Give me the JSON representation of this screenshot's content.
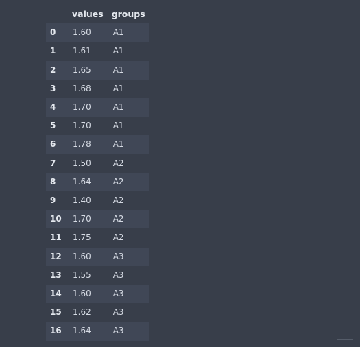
{
  "table": {
    "columns": [
      "",
      "values",
      "groups"
    ],
    "rows": [
      {
        "index": "0",
        "values": "1.60",
        "groups": "A1"
      },
      {
        "index": "1",
        "values": "1.61",
        "groups": "A1"
      },
      {
        "index": "2",
        "values": "1.65",
        "groups": "A1"
      },
      {
        "index": "3",
        "values": "1.68",
        "groups": "A1"
      },
      {
        "index": "4",
        "values": "1.70",
        "groups": "A1"
      },
      {
        "index": "5",
        "values": "1.70",
        "groups": "A1"
      },
      {
        "index": "6",
        "values": "1.78",
        "groups": "A1"
      },
      {
        "index": "7",
        "values": "1.50",
        "groups": "A2"
      },
      {
        "index": "8",
        "values": "1.64",
        "groups": "A2"
      },
      {
        "index": "9",
        "values": "1.40",
        "groups": "A2"
      },
      {
        "index": "10",
        "values": "1.70",
        "groups": "A2"
      },
      {
        "index": "11",
        "values": "1.75",
        "groups": "A2"
      },
      {
        "index": "12",
        "values": "1.60",
        "groups": "A3"
      },
      {
        "index": "13",
        "values": "1.55",
        "groups": "A3"
      },
      {
        "index": "14",
        "values": "1.60",
        "groups": "A3"
      },
      {
        "index": "15",
        "values": "1.62",
        "groups": "A3"
      },
      {
        "index": "16",
        "values": "1.64",
        "groups": "A3"
      }
    ]
  }
}
